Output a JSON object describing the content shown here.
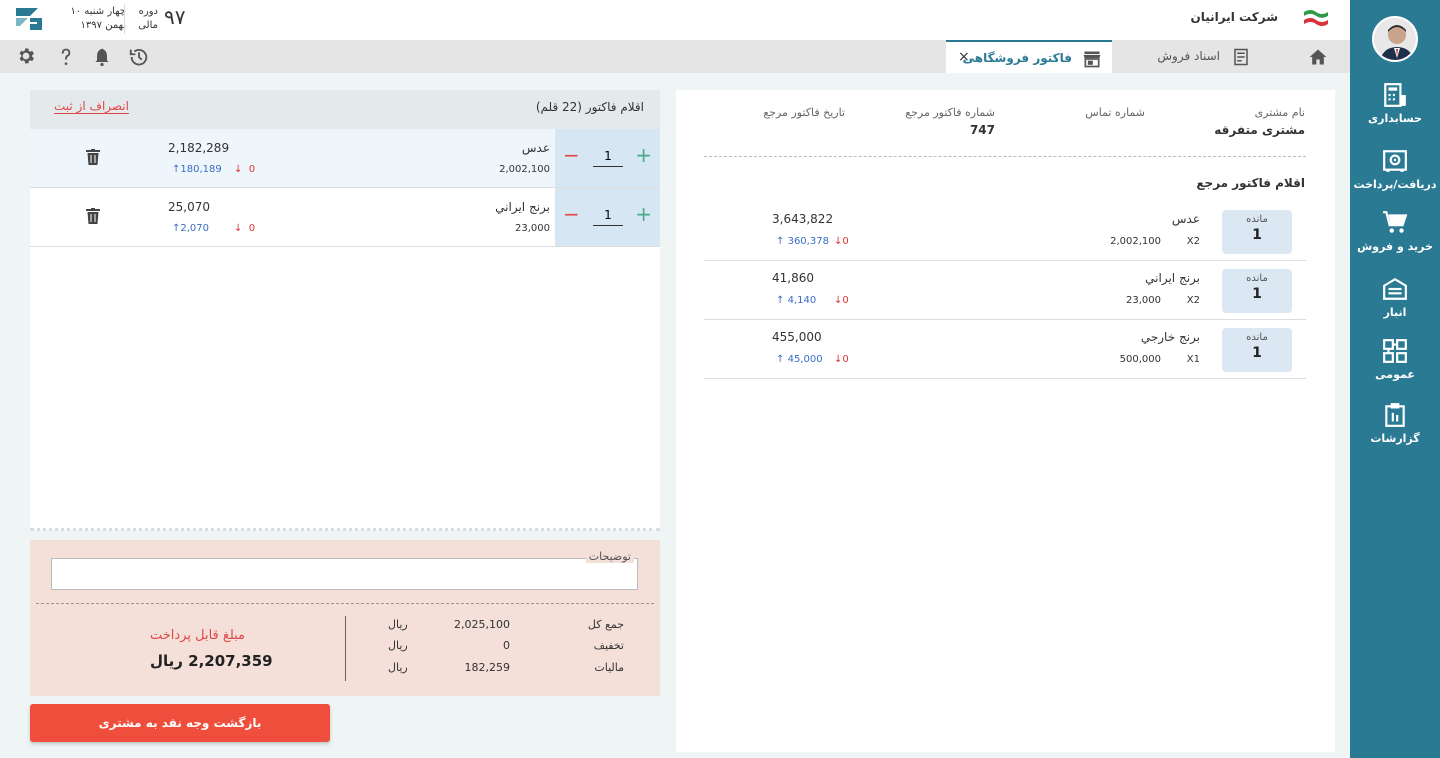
{
  "sidebar": {
    "items": [
      {
        "label": "حسابداری",
        "icon": "accounting-icon"
      },
      {
        "label": "دریافت/پرداخت",
        "icon": "safe-icon"
      },
      {
        "label": "خرید و فروش",
        "icon": "cart-icon"
      },
      {
        "label": "انبار",
        "icon": "warehouse-icon"
      },
      {
        "label": "عمومی",
        "icon": "grid-icon"
      },
      {
        "label": "گزارشات",
        "icon": "clipboard-icon"
      }
    ]
  },
  "header": {
    "company": "شرکت ایرانیان",
    "date_line1": "چهار شنبه ۱۰",
    "date_line2": "بهمن ۱۳۹۷",
    "period_line1": "دوره",
    "period_line2": "مالی",
    "period_number": "۹۷"
  },
  "tabs": {
    "sales_docs": "اسناد فروش",
    "store_invoice": "فاکتور فروشگاهی",
    "close": "×"
  },
  "reference": {
    "customer_label": "نام مشتری",
    "customer_value": "مشتری متفرقه",
    "contact_label": "شماره تماس",
    "ref_no_label": "شماره فاکتور مرجع",
    "ref_no_value": "747",
    "ref_date_label": "تاریخ فاکتور مرجع",
    "items_title": "اقلام فاکتور مرجع",
    "remain_label": "مانده",
    "rows": [
      {
        "remain": "1",
        "name": "عدس",
        "qty": "X2",
        "price": "2,002,100",
        "total": "3,643,822",
        "up": "360,378",
        "down": "0"
      },
      {
        "remain": "1",
        "name": "برنج ايراني",
        "qty": "X2",
        "price": "23,000",
        "total": "41,860",
        "up": "4,140",
        "down": "0"
      },
      {
        "remain": "1",
        "name": "برنج خارجي",
        "qty": "X1",
        "price": "500,000",
        "total": "455,000",
        "up": "45,000",
        "down": "0"
      }
    ]
  },
  "items": {
    "title": "اقلام فاکتور (22 قلم)",
    "cancel": "انصراف از ثبت",
    "rows": [
      {
        "qty": "1",
        "name": "عدس",
        "price": "2,002,100",
        "total": "2,182,289",
        "up": "180,189",
        "down": "0"
      },
      {
        "qty": "1",
        "name": "برنج ايراني",
        "price": "23,000",
        "total": "25,070",
        "up": "2,070",
        "down": "0"
      }
    ]
  },
  "summary": {
    "notes_label": "توضیحات",
    "notes_value": "",
    "total_label": "جمع کل",
    "total_value": "2,025,100",
    "discount_label": "تخفیف",
    "discount_value": "0",
    "tax_label": "مالیات",
    "tax_value": "182,259",
    "currency": "ریال",
    "payable_label": "مبلغ قابل پرداخت",
    "payable_value": "2,207,359 ریال"
  },
  "actions": {
    "refund_button": "بازگشت وجه نقد به مشتری"
  },
  "colors": {
    "sidebar": "#2b7a94",
    "accent_red": "#ef4e3c",
    "summary_bg": "#f5dfd9"
  }
}
